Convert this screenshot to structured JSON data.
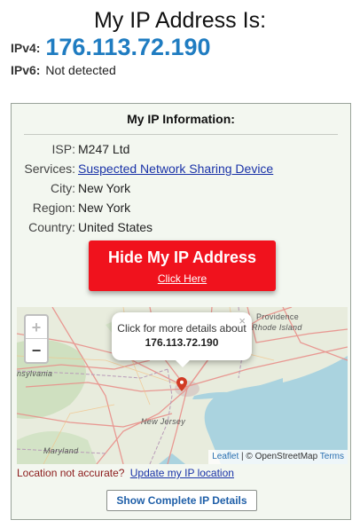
{
  "header": {
    "title": "My IP Address Is:",
    "ipv4_label": "IPv4:",
    "ipv4_value": "176.113.72.190",
    "ipv6_label": "IPv6:",
    "ipv6_value": "Not detected"
  },
  "info": {
    "title": "My IP Information:",
    "rows": [
      {
        "label": "ISP:",
        "value": "M247 Ltd"
      },
      {
        "label": "Services:",
        "value": "Suspected Network Sharing Device"
      },
      {
        "label": "City:",
        "value": "New York"
      },
      {
        "label": "Region:",
        "value": "New York"
      },
      {
        "label": "Country:",
        "value": "United States"
      }
    ]
  },
  "hide_button": {
    "label": "Hide My IP Address",
    "sublabel": "Click Here"
  },
  "map": {
    "zoom_in": "+",
    "zoom_out": "−",
    "popup_text": "Click for more details about",
    "popup_ip": "176.113.72.190",
    "popup_close": "×",
    "labels": [
      "Rhode Island",
      "Providence",
      "nsylvania",
      "New Jersey",
      "Maryland"
    ],
    "attribution": {
      "leaflet": "Leaflet",
      "separator": " | © OpenStreetMap ",
      "terms": "Terms"
    }
  },
  "accuracy": {
    "question": "Location not accurate?",
    "link": "Update my IP location"
  },
  "details_button": {
    "label": "Show Complete IP Details"
  },
  "colors": {
    "ip_blue": "#1f7cc1",
    "hide_red": "#f0121d",
    "panel_bg": "#f3f7f0",
    "marker": "#d13a24"
  }
}
